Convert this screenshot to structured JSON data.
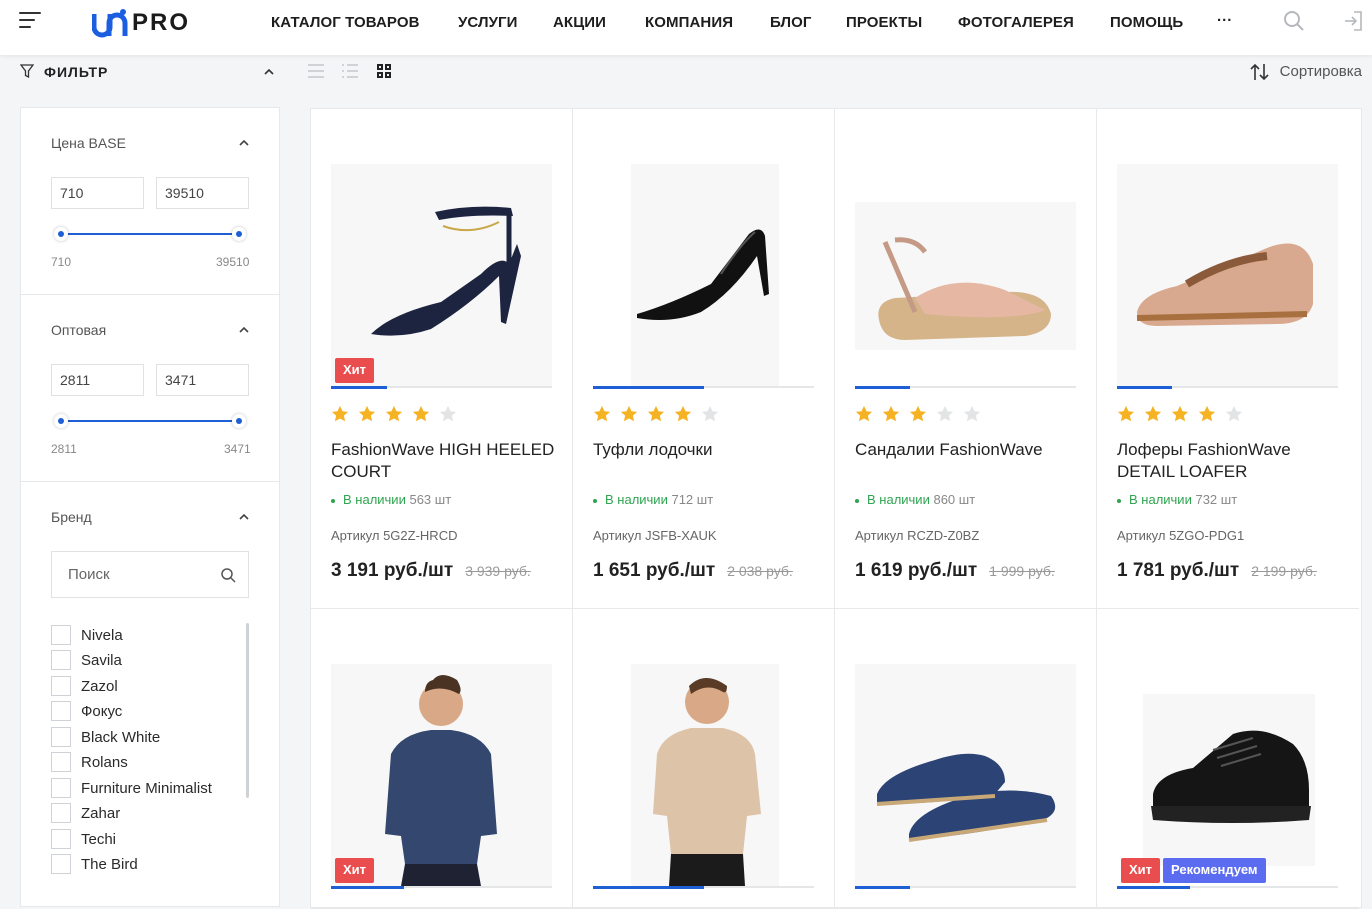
{
  "header": {
    "logo_text": "PRO",
    "logo_mark": "UNI",
    "nav": [
      "КАТАЛОГ ТОВАРОВ",
      "УСЛУГИ",
      "АКЦИИ",
      "КОМПАНИЯ",
      "БЛОГ",
      "ПРОЕКТЫ",
      "ФОТОГАЛЕРЕЯ",
      "ПОМОЩЬ",
      "···"
    ],
    "icons": [
      "menu-icon",
      "search-icon",
      "login-icon"
    ]
  },
  "filter": {
    "title": "ФИЛЬТР",
    "sections": [
      {
        "title": "Цена BASE",
        "min_value": "710",
        "max_value": "39510",
        "range_min_label": "710",
        "range_max_label": "39510"
      },
      {
        "title": "Оптовая",
        "min_value": "2811",
        "max_value": "3471",
        "range_min_label": "2811",
        "range_max_label": "3471"
      },
      {
        "title": "Бренд"
      }
    ],
    "brand_search_placeholder": "Поиск",
    "brands": [
      "Nivela",
      "Savila",
      "Zazol",
      "Фокус",
      "Black White",
      "Rolans",
      "Furniture Minimalist",
      "Zahar",
      "Techi",
      "The Bird"
    ]
  },
  "toolbar": {
    "view_modes": [
      "list-view-icon",
      "compact-list-icon",
      "grid-view-icon"
    ],
    "active_view": "grid",
    "sort_label": "Сортировка"
  },
  "colors": {
    "accent": "#1e5fd6",
    "badge_hit": "#e94d4d",
    "badge_recommend": "#5b6cf0",
    "star": "#f5b324",
    "in_stock": "#2ea44f"
  },
  "products": [
    {
      "name": "FashionWave HIGH HEELED COURT",
      "rating": 4,
      "stock_label": "В наличии",
      "stock_qty": "563 шт",
      "article": "Артикул 5G2Z-HRCD",
      "price": "3 191 руб./шт",
      "old_price": "3 939 руб.",
      "badges": [
        "Хит"
      ],
      "image": "navy-ankle-strap-heel"
    },
    {
      "name": "Туфли лодочки",
      "rating": 4,
      "stock_label": "В наличии",
      "stock_qty": "712 шт",
      "article": "Артикул JSFB-XAUK",
      "price": "1 651 руб./шт",
      "old_price": "2 038 руб.",
      "badges": [],
      "image": "black-patent-pump"
    },
    {
      "name": "Сандалии FashionWave",
      "rating": 3,
      "stock_label": "В наличии",
      "stock_qty": "860 шт",
      "article": "Артикул RCZD-Z0BZ",
      "price": "1 619 руб./шт",
      "old_price": "1 999 руб.",
      "badges": [],
      "image": "espadrille-sandal"
    },
    {
      "name": "Лоферы FashionWave DETAIL LOAFER",
      "rating": 4,
      "stock_label": "В наличии",
      "stock_qty": "732 шт",
      "article": "Артикул 5ZGO-PDG1",
      "price": "1 781 руб./шт",
      "old_price": "2 199 руб.",
      "badges": [],
      "image": "rose-gold-loafer"
    },
    {
      "name": "",
      "badges": [
        "Хит"
      ],
      "image": "man-in-navy-shirt"
    },
    {
      "name": "",
      "badges": [],
      "image": "man-in-beige-tshirt"
    },
    {
      "name": "",
      "badges": [],
      "image": "navy-penny-loafers"
    },
    {
      "name": "",
      "badges": [
        "Хит",
        "Рекомендуем"
      ],
      "image": "black-derby-shoe"
    }
  ]
}
